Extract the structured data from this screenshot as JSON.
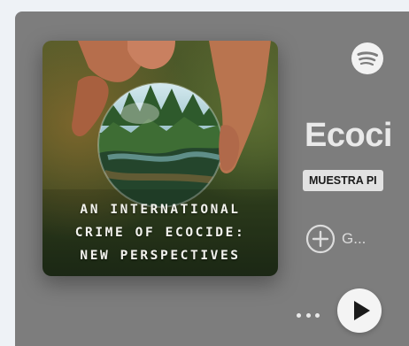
{
  "episode": {
    "cover_title_lines": [
      "AN INTERNATIONAL",
      "CRIME OF ECOCIDE:",
      "NEW PERSPECTIVES"
    ],
    "show_title": "Ecoci",
    "badge": "MUESTRA PI",
    "follow_label": "G..."
  },
  "icons": {
    "logo": "spotify-icon",
    "follow": "plus-circle-icon",
    "more": "more-options-icon",
    "play": "play-icon"
  },
  "colors": {
    "page_background": "#eef2f6",
    "card_background": "#7d7d7d",
    "play_button": "#f4f4f4",
    "badge_background": "#e2e2e2"
  }
}
